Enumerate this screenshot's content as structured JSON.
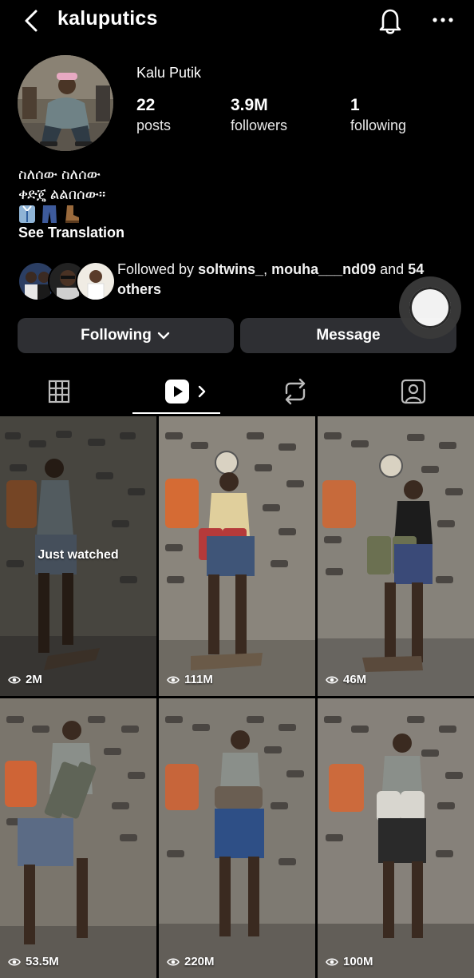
{
  "header": {
    "username": "kaluputics",
    "icons": {
      "back": "chevron-left-icon",
      "notifications": "bell-icon",
      "more": "more-horizontal-icon"
    }
  },
  "profile": {
    "display_name": "Kalu Putik",
    "stats": {
      "posts": {
        "count": "22",
        "label": "posts"
      },
      "followers": {
        "count": "3.9M",
        "label": "followers"
      },
      "following": {
        "count": "1",
        "label": "following"
      }
    },
    "bio_lines": [
      "ስለሰው ስለሰው",
      "ቀድጄ ልልበሰው።"
    ],
    "bio_emojis": [
      "shirt",
      "jeans",
      "boot"
    ],
    "see_translation": "See Translation",
    "followed_by": {
      "prefix": "Followed by ",
      "user1": "soltwins_",
      "separator": ", ",
      "user2": "mouha___nd09",
      "and": " and ",
      "others": "54 others"
    }
  },
  "actions": {
    "following_label": "Following",
    "message_label": "Message"
  },
  "tabs": [
    {
      "name": "grid",
      "icon": "grid-icon"
    },
    {
      "name": "reels",
      "icon": "reels-icon",
      "active": true
    },
    {
      "name": "reposts",
      "icon": "repost-icon"
    },
    {
      "name": "tagged",
      "icon": "tagged-person-icon"
    }
  ],
  "reels": [
    {
      "views": "2M",
      "overlay": "Just watched"
    },
    {
      "views": "111M"
    },
    {
      "views": "46M"
    },
    {
      "views": "53.5M"
    },
    {
      "views": "220M"
    },
    {
      "views": "100M"
    }
  ],
  "colors": {
    "background": "#000000",
    "button_bg": "#2e2f33",
    "text": "#ffffff",
    "wall": "#7d786f"
  }
}
